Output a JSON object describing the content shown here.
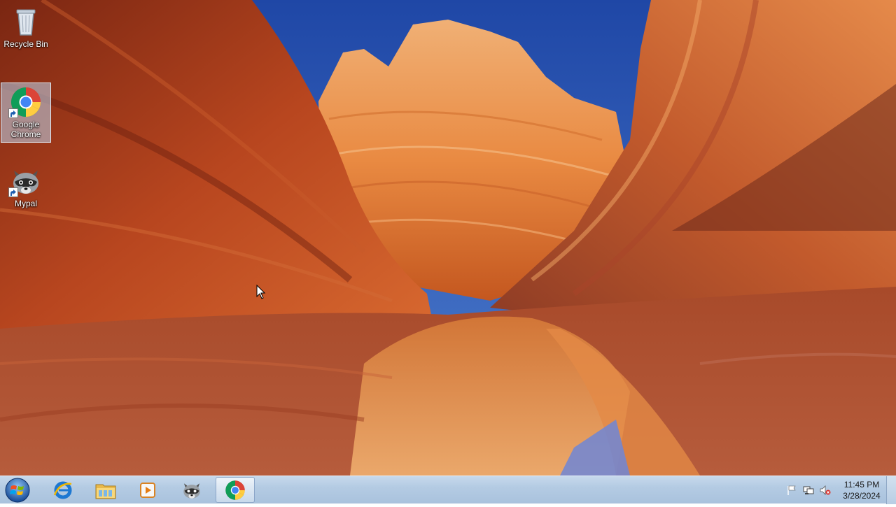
{
  "desktop": {
    "icons": [
      {
        "label": "Recycle Bin",
        "icon": "recycle-bin-icon"
      },
      {
        "label": "Google Chrome",
        "icon": "chrome-icon",
        "selected": true
      },
      {
        "label": "Mypal",
        "icon": "mypal-raccoon-icon"
      }
    ]
  },
  "taskbar": {
    "start": {
      "icon": "windows-logo-icon"
    },
    "pinned": [
      {
        "icon": "internet-explorer-icon"
      },
      {
        "icon": "file-explorer-icon"
      },
      {
        "icon": "media-player-icon"
      },
      {
        "icon": "mypal-raccoon-icon"
      },
      {
        "icon": "chrome-icon",
        "active": true
      }
    ],
    "tray": {
      "icons": [
        "action-center-flag-icon",
        "network-icon",
        "volume-muted-icon"
      ],
      "time": "11:45 PM",
      "date": "3/28/2024"
    }
  },
  "colors": {
    "sky": "#2e5cb8",
    "rock_dark": "#8e2d18",
    "rock_light": "#f2a25e",
    "taskbar": "#b4cbe3"
  }
}
